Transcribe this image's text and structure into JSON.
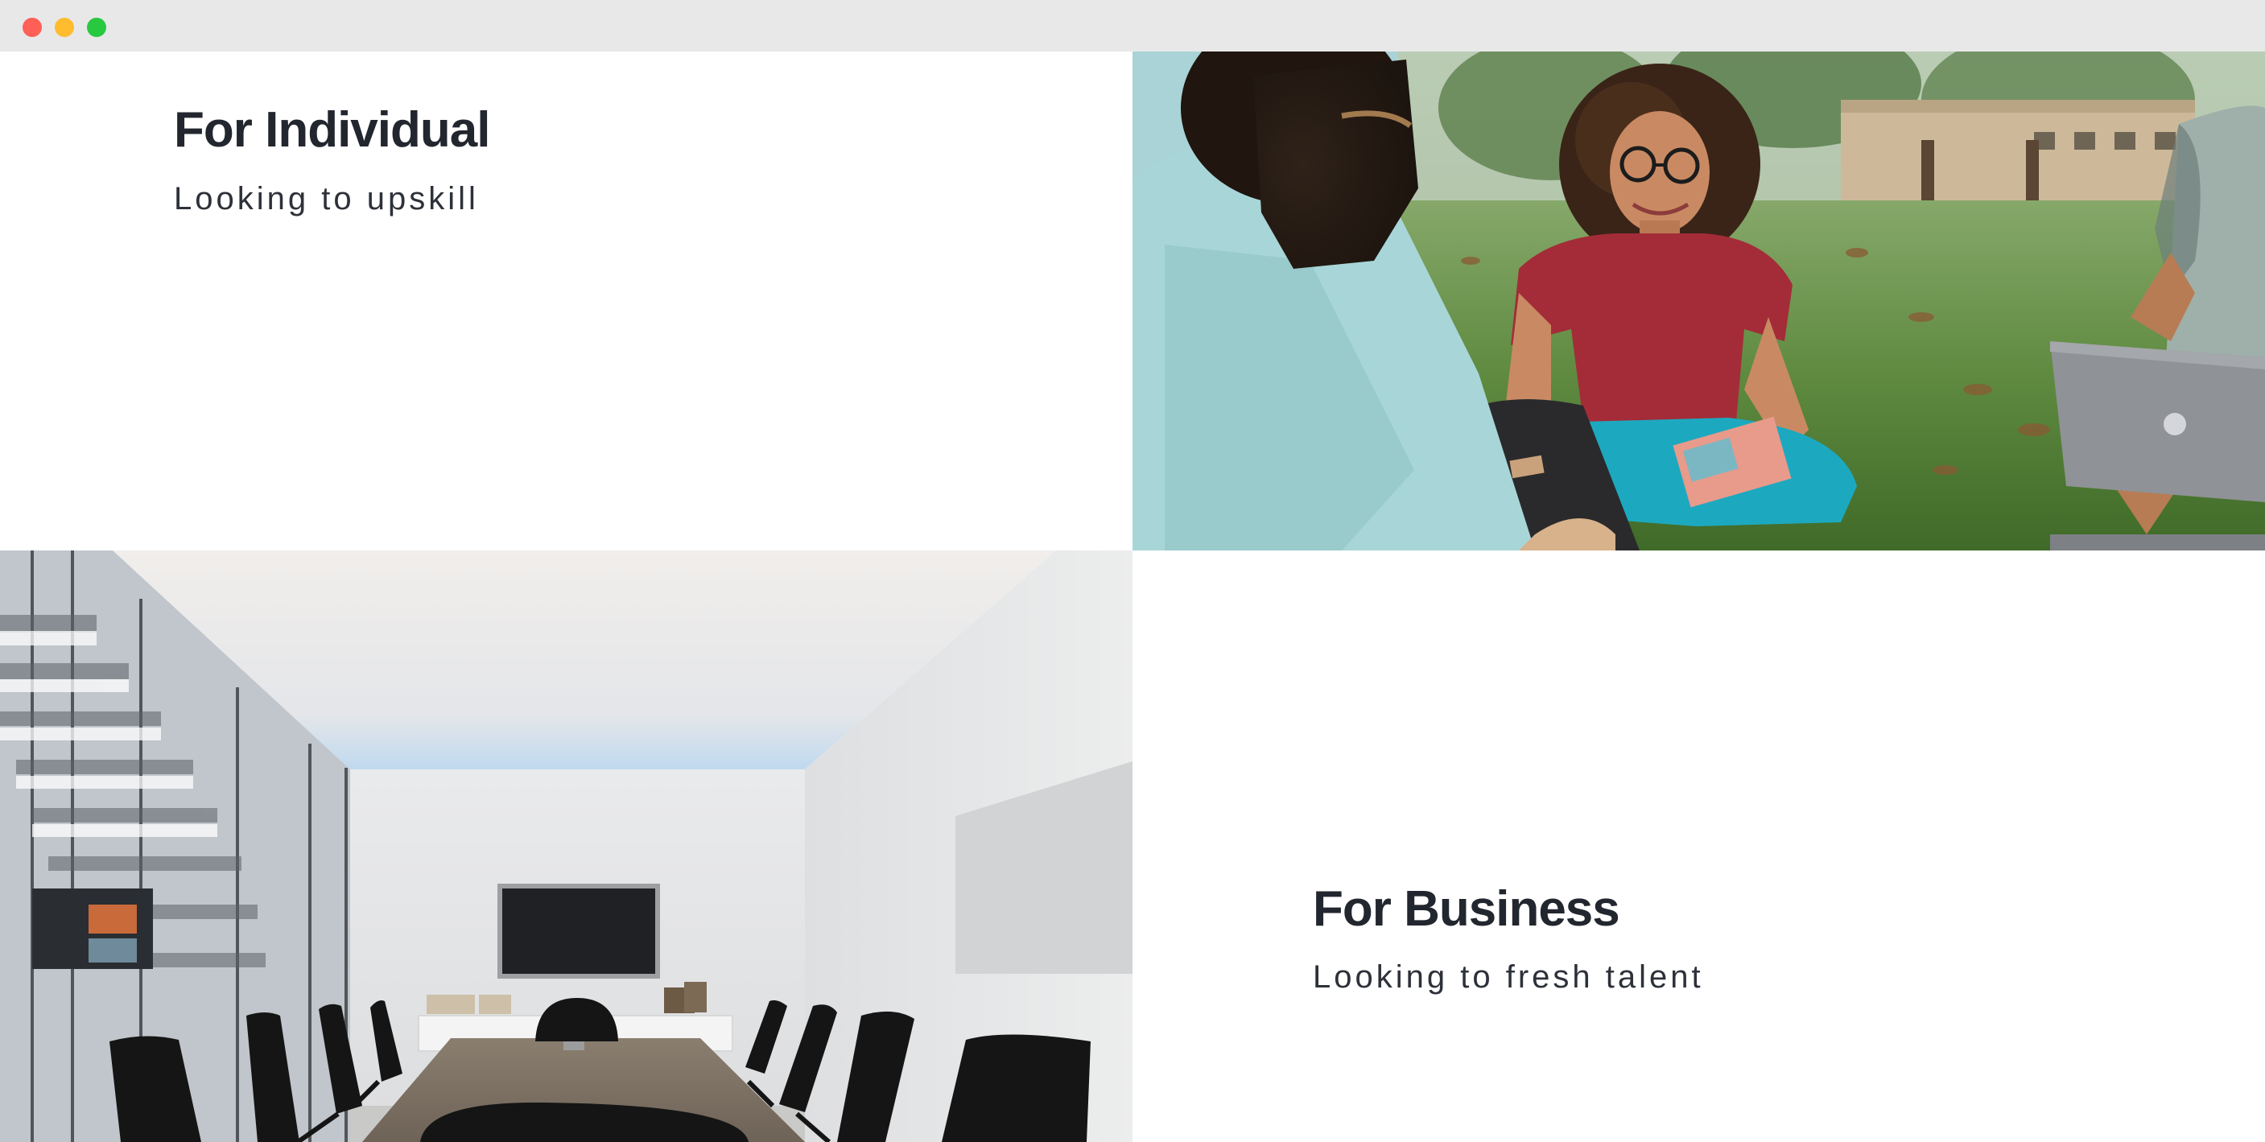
{
  "individual": {
    "title": "For Individual",
    "subtitle": "Looking to upskill",
    "photo": "students-sitting-on-grass-with-laptop"
  },
  "business": {
    "title": "For Business",
    "subtitle": "Looking to fresh talent",
    "photo": "empty-conference-room-with-black-chairs"
  },
  "colors": {
    "heading": "#22262e",
    "subheading": "#2d3139",
    "titlebar": "#e8e8e8",
    "traffic_close": "#fe5f57",
    "traffic_minimize": "#febc2e",
    "traffic_maximize": "#28c840"
  }
}
